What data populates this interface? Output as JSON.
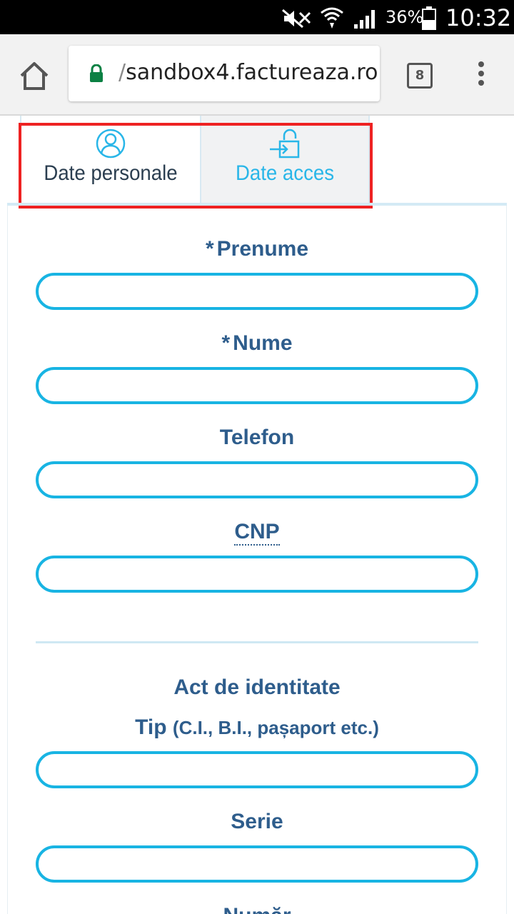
{
  "status_bar": {
    "battery_percent": "36%",
    "time": "10:32",
    "icons": [
      "mute-icon",
      "wifi-icon",
      "signal-icon",
      "battery-icon"
    ]
  },
  "browser": {
    "url_prefix": "/",
    "url": "sandbox4.factureaza.ro",
    "tab_count": "8",
    "icons": [
      "home-icon",
      "lock-icon",
      "tabs-icon",
      "menu-icon"
    ]
  },
  "tabs": [
    {
      "label": "Date personale",
      "icon": "user-icon",
      "active": true
    },
    {
      "label": "Date acces",
      "icon": "login-lock-icon",
      "active": false
    }
  ],
  "form": {
    "required_marker": "*",
    "prenume_label": "Prenume",
    "nume_label": "Nume",
    "telefon_label": "Telefon",
    "cnp_label": "CNP",
    "section_title": "Act de identitate",
    "tip_label": "Tip",
    "tip_hint": "(C.I., B.I., pașaport etc.)",
    "serie_label": "Serie",
    "numar_label": "Număr",
    "prenume_value": "",
    "nume_value": "",
    "telefon_value": "",
    "cnp_value": "",
    "tip_value": "",
    "serie_value": ""
  },
  "colors": {
    "accent": "#18b4e3",
    "label": "#2e5d8c",
    "highlight": "#ee2222"
  }
}
